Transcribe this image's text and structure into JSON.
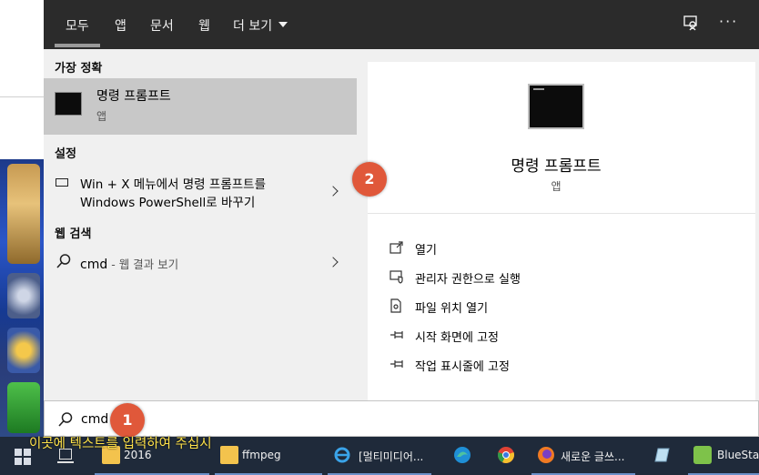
{
  "filter_bar": {
    "tabs": [
      "모두",
      "앱",
      "문서",
      "웹",
      "더 보기"
    ],
    "more_options": "···"
  },
  "results": {
    "best_match_heading": "가장 정확",
    "best_match": {
      "title": "명령 프롬프트",
      "subtitle": "앱"
    },
    "settings_heading": "설정",
    "setting_item": {
      "line1": "Win + X 메뉴에서 명령 프롬프트를",
      "line2": "Windows PowerShell로 바꾸기"
    },
    "web_heading": "웹 검색",
    "web_item": {
      "query": "cmd",
      "description": " - 웹 결과 보기"
    }
  },
  "preview": {
    "title": "명령 프롬프트",
    "subtitle": "앱",
    "actions": [
      "열기",
      "관리자 권한으로 실행",
      "파일 위치 열기",
      "시작 화면에 고정",
      "작업 표시줄에 고정"
    ]
  },
  "search_box": {
    "value": "cmd"
  },
  "badges": {
    "first": "1",
    "second": "2"
  },
  "hint": "이곳에 텍스트를 입력하여 주십시",
  "taskbar": {
    "items": [
      {
        "label": "2016",
        "icon": "folder-icon"
      },
      {
        "label": "ffmpeg",
        "icon": "folder-icon"
      },
      {
        "label": "[멀티미디어...",
        "icon": "internet-explorer-icon"
      },
      {
        "label": "",
        "icon": "edge-icon"
      },
      {
        "label": "",
        "icon": "chrome-icon"
      },
      {
        "label": "새로운 글쓰...",
        "icon": "firefox-icon"
      },
      {
        "label": "",
        "icon": "notes-app-icon"
      },
      {
        "label": "BlueStac",
        "icon": "bluestacks-icon"
      }
    ]
  },
  "colors": {
    "accent_badge": "#e0583a",
    "filter_bar": "#2b2b2b",
    "taskbar": "#1f2a3a",
    "hint": "#ffe24a"
  }
}
